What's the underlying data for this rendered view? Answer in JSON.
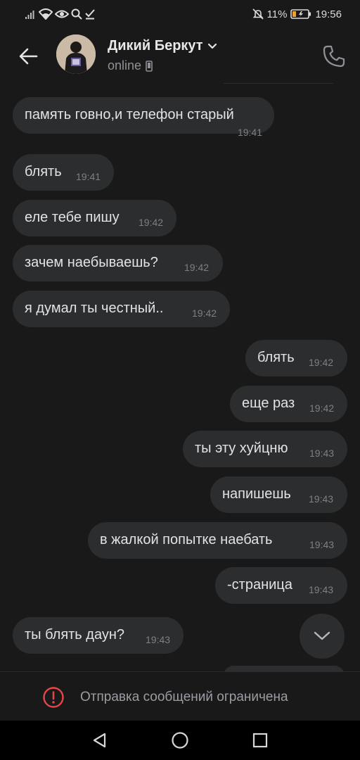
{
  "status_bar": {
    "battery_percent": "11%",
    "time": "19:56",
    "icons_left": [
      "signal-icon",
      "wifi-icon",
      "eye-icon",
      "search-icon",
      "check-icon"
    ],
    "icons_right": [
      "mute-icon",
      "battery-icon"
    ]
  },
  "header": {
    "contact_name": "Дикий Беркут",
    "status": "online",
    "status_device_icon": "phone-icon",
    "back_icon": "arrow-left-icon",
    "call_icon": "phone-call-icon",
    "dropdown_icon": "chevron-down-icon"
  },
  "messages": [
    {
      "direction": "in",
      "text": "память говно,и телефон старый",
      "time": "19:41"
    },
    {
      "direction": "in",
      "text": "блять",
      "time": "19:41"
    },
    {
      "direction": "in",
      "text": "еле тебе пишу",
      "time": "19:42"
    },
    {
      "direction": "in",
      "text": "зачем наебываешь?",
      "time": "19:42"
    },
    {
      "direction": "in",
      "text": "я думал ты честный..",
      "time": "19:42"
    },
    {
      "direction": "out",
      "text": "блять",
      "time": "19:42"
    },
    {
      "direction": "out",
      "text": "еще раз",
      "time": "19:42"
    },
    {
      "direction": "out",
      "text": "ты эту хуйцню",
      "time": "19:43"
    },
    {
      "direction": "out",
      "text": "напишешь",
      "time": "19:43"
    },
    {
      "direction": "out",
      "text": "в жалкой попытке наебать",
      "time": "19:43"
    },
    {
      "direction": "out",
      "text": "-страница",
      "time": "19:43"
    },
    {
      "direction": "in",
      "text": "ты блять даун?",
      "time": "19:43"
    }
  ],
  "restricted_notice": {
    "text": "Отправка сообщений ограничена",
    "icon": "alert-circle-icon",
    "icon_color": "#e64646"
  },
  "nav": {
    "back_icon": "nav-back-icon",
    "home_icon": "nav-home-icon",
    "recents_icon": "nav-recents-icon"
  },
  "colors": {
    "background": "#19191a",
    "bubble": "#2c2d2e",
    "text": "#e1e3e6",
    "secondary_text": "#8e9196"
  }
}
